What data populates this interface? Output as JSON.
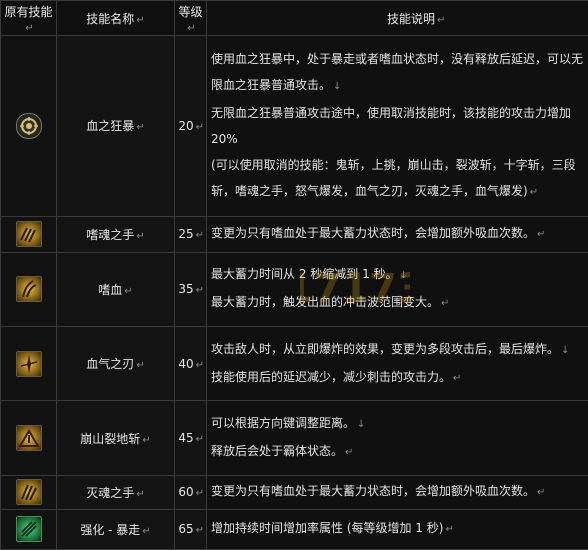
{
  "headers": {
    "owned": "原有技能",
    "name": "技能名称",
    "level": "等级",
    "desc": "技能说明"
  },
  "para_mark": "↵",
  "line_mark": "↓",
  "rows": [
    {
      "icon": "blood-frenzy-icon",
      "name": "血之狂暴",
      "level": "20",
      "lines": [
        "使用血之狂暴中，处于暴走或者嗜血状态时，没有释放后延迟，可以无限血之狂暴普通攻击。",
        "无限血之狂暴普通攻击途中，使用取消技能时，该技能的攻击力增加 20%",
        "(可以使用取消的技能：鬼斩，上挑，崩山击，裂波斩，十字斩，三段斩，嗜魂之手，怒气爆发，血气之刃，灭魂之手，血气爆发)"
      ]
    },
    {
      "icon": "soul-devour-hand-icon",
      "name": "嗜魂之手",
      "level": "25",
      "lines": [
        "变更为只有嗜血处于最大蓄力状态时，会增加额外吸血次数。"
      ]
    },
    {
      "icon": "bloodlust-icon",
      "name": "嗜血",
      "level": "35",
      "lines": [
        "最大蓄力时间从 2 秒缩减到 1 秒。",
        "最大蓄力时，触发出血的冲击波范围变大。"
      ]
    },
    {
      "icon": "blood-blade-icon",
      "name": "血气之刃",
      "level": "40",
      "lines": [
        "攻击敌人时，从立即爆炸的效果，变更为多段攻击后，最后爆炸。",
        "技能使用后的延迟减少，减少刺击的攻击力。"
      ]
    },
    {
      "icon": "mountain-crash-icon",
      "name": "崩山裂地斩",
      "level": "45",
      "lines": [
        "可以根据方向键调整距离。",
        "释放后会处于霸体状态。"
      ]
    },
    {
      "icon": "soul-destroy-hand-icon",
      "name": "灭魂之手",
      "level": "60",
      "lines": [
        "变更为只有嗜血处于最大蓄力状态时，会增加额外吸血次数。"
      ]
    },
    {
      "icon": "enhance-frenzy-icon",
      "name": "强化 - 暴走",
      "level": "65",
      "lines": [
        "增加持续时间增加率属性 (每等级增加 1 秒)"
      ]
    }
  ],
  "watermark_text": "17173"
}
